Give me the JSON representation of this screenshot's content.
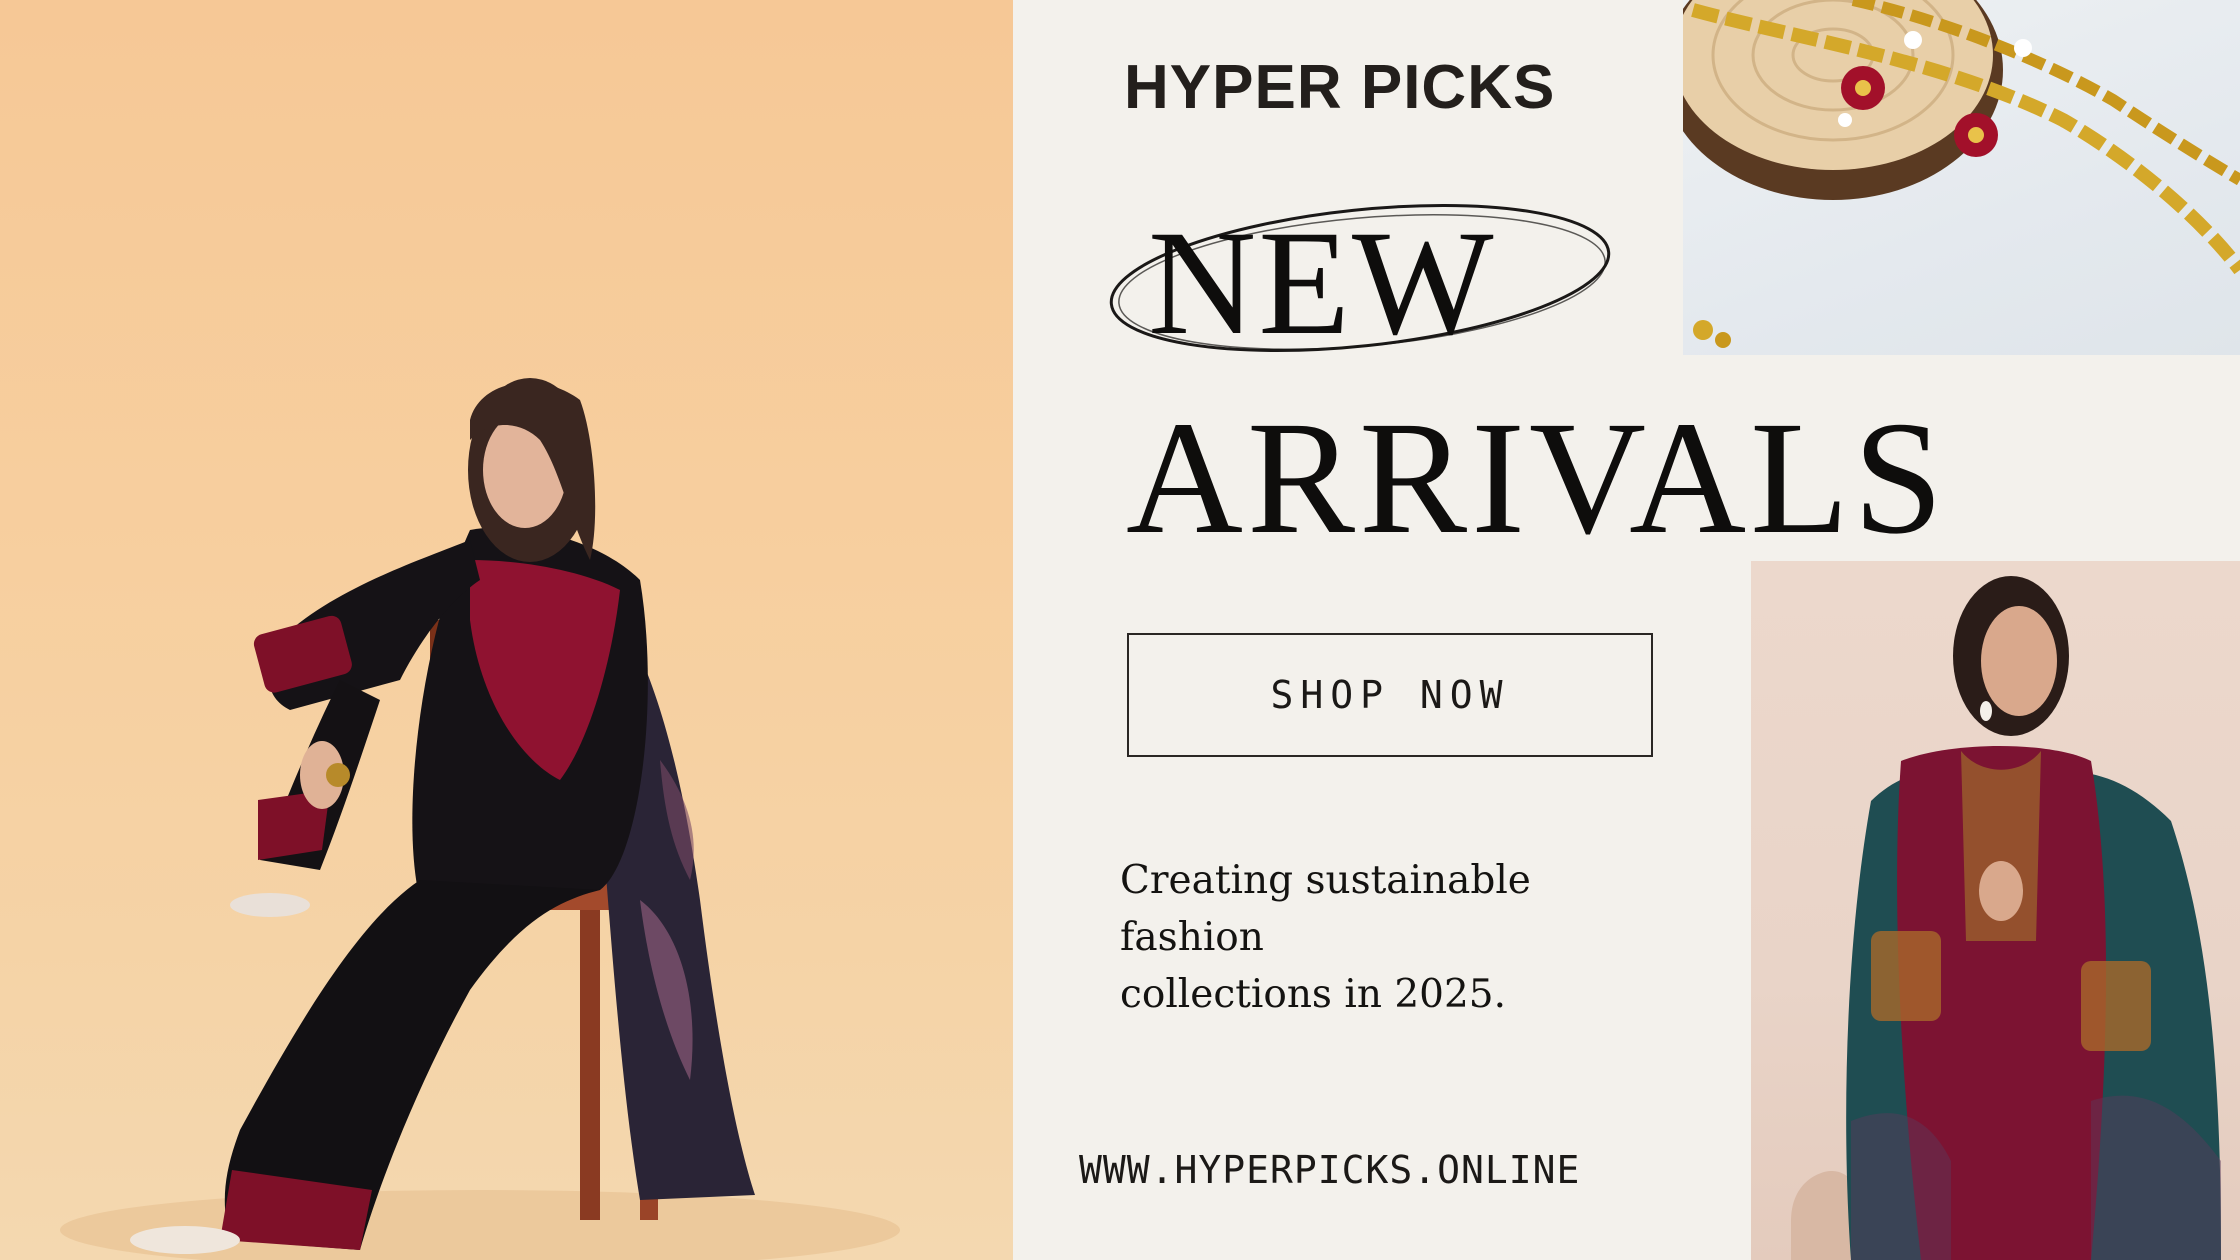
{
  "brand": {
    "name": "HYPER PICKS"
  },
  "hero": {
    "title_line1": "NEW",
    "title_line2": "ARRIVALS"
  },
  "cta": {
    "label": "SHOP NOW"
  },
  "tagline": {
    "line1": "Creating sustainable fashion",
    "line2": "collections in 2025."
  },
  "footer": {
    "website": "WWW.HYPERPICKS.ONLINE"
  },
  "colors": {
    "background": "#f3f1ec",
    "text_dark": "#0e0d0c",
    "left_backdrop": "#f6c896",
    "jewel_gold": "#d4a82a",
    "jewel_red": "#a2102a",
    "outfit_black": "#141214",
    "embroidery_red": "#8f1230",
    "outfit_maroon": "#7c1332",
    "shawl_teal": "#1f4d52"
  }
}
